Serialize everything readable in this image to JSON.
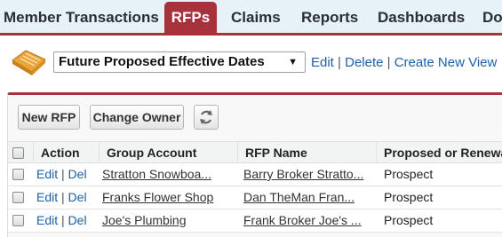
{
  "tabs": [
    {
      "label": "Member Transactions"
    },
    {
      "label": "RFPs"
    },
    {
      "label": "Claims"
    },
    {
      "label": "Reports"
    },
    {
      "label": "Dashboards"
    },
    {
      "label": "Do"
    }
  ],
  "active_tab": "RFPs",
  "view": {
    "selected": "Future Proposed Effective Dates",
    "caret": "▼",
    "edit": "Edit",
    "delete": "Delete",
    "create": "Create New View",
    "sep": "|"
  },
  "toolbar": {
    "new_rfp": "New RFP",
    "change_owner": "Change Owner"
  },
  "table": {
    "headers": [
      "Action",
      "Group Account",
      "RFP Name",
      "Proposed or Renewa"
    ],
    "edit_label": "Edit",
    "del_label": "Del",
    "sep": "|",
    "rows": [
      {
        "group_account": "Stratton Snowboa...",
        "rfp_name": "Barry Broker Stratto...",
        "status": "Prospect"
      },
      {
        "group_account": "Franks Flower Shop",
        "rfp_name": "Dan TheMan Fran...",
        "status": "Prospect"
      },
      {
        "group_account": "Joe's Plumbing",
        "rfp_name": "Frank Broker Joe's ...",
        "status": "Prospect"
      }
    ]
  },
  "colors": {
    "accent": "#a8323c",
    "tab_bg": "#e6f1f8",
    "link": "#1f5fa4"
  },
  "icons": {
    "app": "rfp-document-icon",
    "refresh": "refresh-icon"
  }
}
